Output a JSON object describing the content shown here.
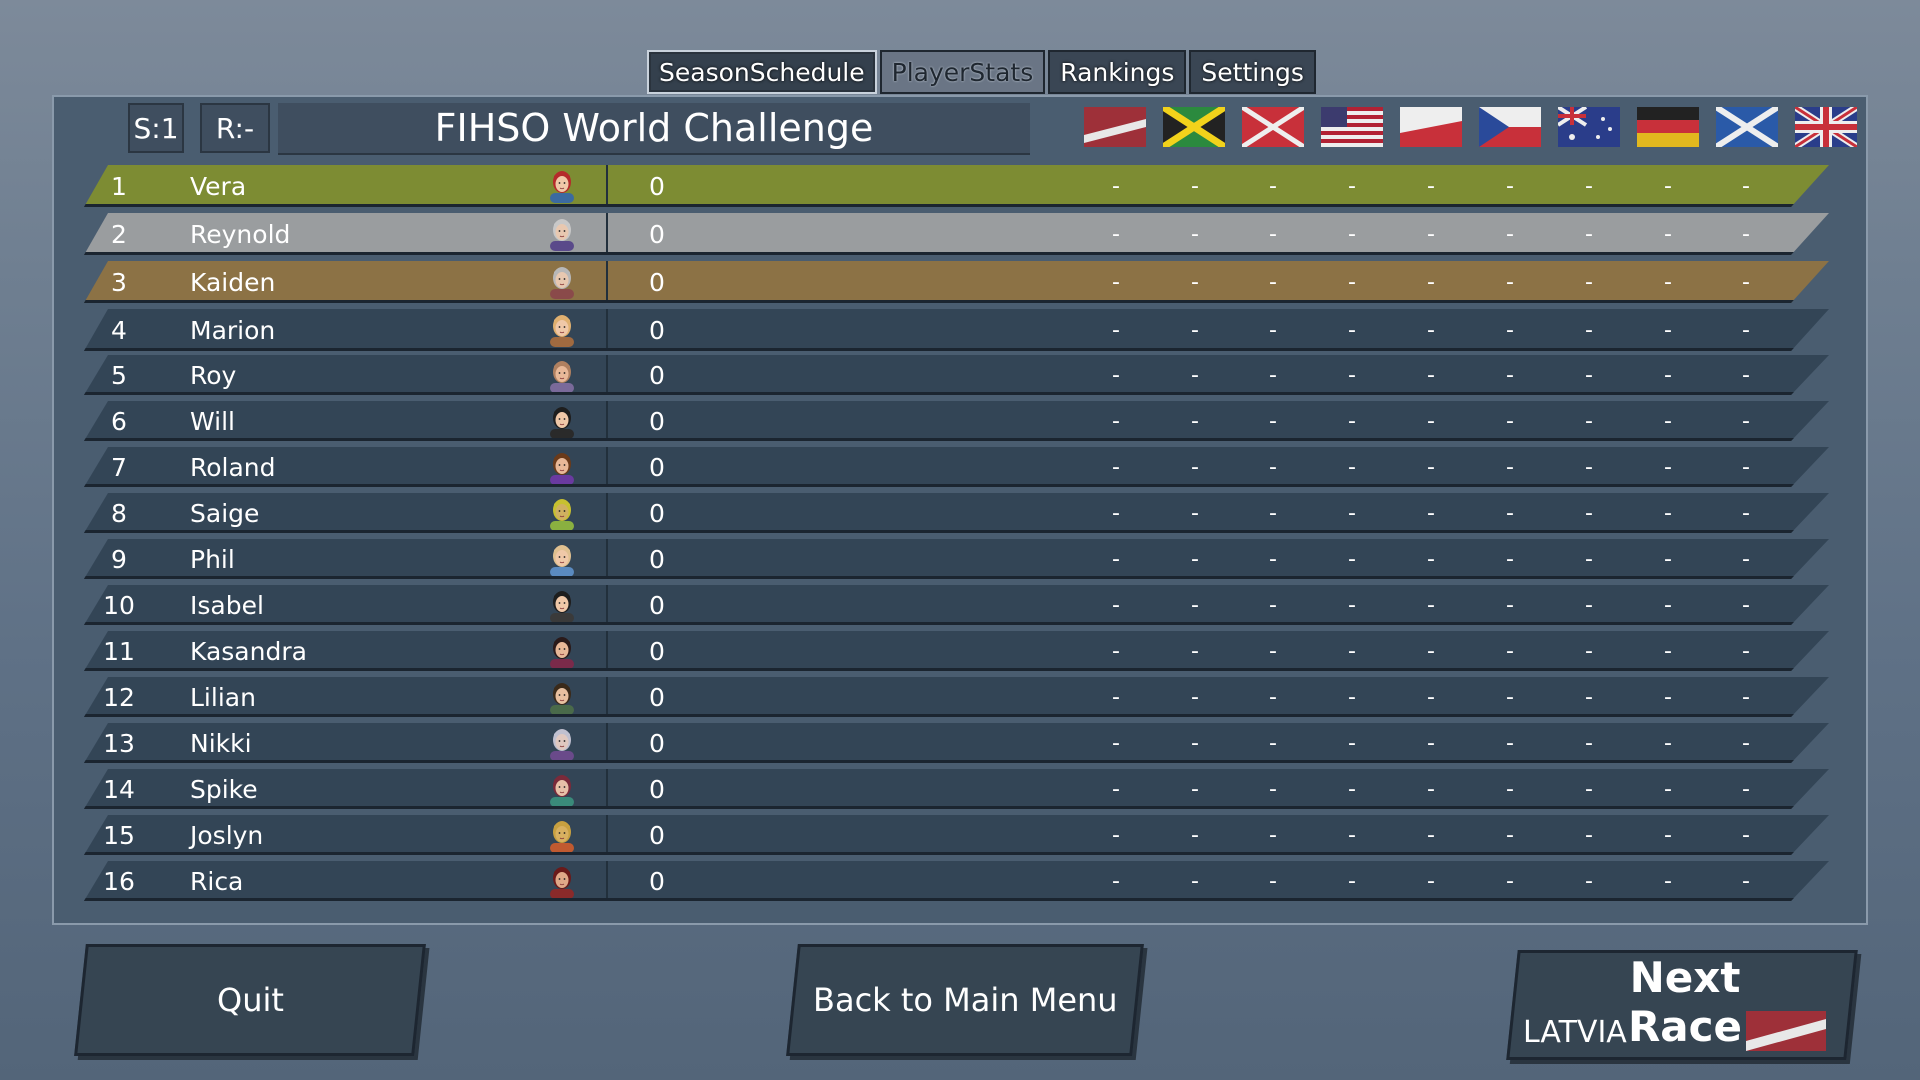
{
  "tabs": [
    {
      "label": "SeasonSchedule",
      "state": "active"
    },
    {
      "label": "PlayerStats",
      "state": "dim"
    },
    {
      "label": "Rankings",
      "state": "normal"
    },
    {
      "label": "Settings",
      "state": "normal"
    }
  ],
  "header": {
    "season": "S:1",
    "race": "R:-",
    "title": "FIHSO World Challenge"
  },
  "flags": [
    {
      "name": "latvia-flag"
    },
    {
      "name": "jamaica-flag"
    },
    {
      "name": "red-cross-flag"
    },
    {
      "name": "usa-flag"
    },
    {
      "name": "poland-flag"
    },
    {
      "name": "czech-flag"
    },
    {
      "name": "australia-flag"
    },
    {
      "name": "germany-flag"
    },
    {
      "name": "scotland-flag"
    },
    {
      "name": "uk-flag"
    }
  ],
  "standings": [
    {
      "pos": "1",
      "name": "Vera",
      "score": "0",
      "results": [
        "-",
        "-",
        "-",
        "-",
        "-",
        "-",
        "-",
        "-",
        "-",
        "-"
      ]
    },
    {
      "pos": "2",
      "name": "Reynold",
      "score": "0",
      "results": [
        "-",
        "-",
        "-",
        "-",
        "-",
        "-",
        "-",
        "-",
        "-",
        "-"
      ]
    },
    {
      "pos": "3",
      "name": "Kaiden",
      "score": "0",
      "results": [
        "-",
        "-",
        "-",
        "-",
        "-",
        "-",
        "-",
        "-",
        "-",
        "-"
      ]
    },
    {
      "pos": "4",
      "name": "Marion",
      "score": "0",
      "results": [
        "-",
        "-",
        "-",
        "-",
        "-",
        "-",
        "-",
        "-",
        "-",
        "-"
      ]
    },
    {
      "pos": "5",
      "name": "Roy",
      "score": "0",
      "results": [
        "-",
        "-",
        "-",
        "-",
        "-",
        "-",
        "-",
        "-",
        "-",
        "-"
      ]
    },
    {
      "pos": "6",
      "name": "Will",
      "score": "0",
      "results": [
        "-",
        "-",
        "-",
        "-",
        "-",
        "-",
        "-",
        "-",
        "-",
        "-"
      ]
    },
    {
      "pos": "7",
      "name": "Roland",
      "score": "0",
      "results": [
        "-",
        "-",
        "-",
        "-",
        "-",
        "-",
        "-",
        "-",
        "-",
        "-"
      ]
    },
    {
      "pos": "8",
      "name": "Saige",
      "score": "0",
      "results": [
        "-",
        "-",
        "-",
        "-",
        "-",
        "-",
        "-",
        "-",
        "-",
        "-"
      ]
    },
    {
      "pos": "9",
      "name": "Phil",
      "score": "0",
      "results": [
        "-",
        "-",
        "-",
        "-",
        "-",
        "-",
        "-",
        "-",
        "-",
        "-"
      ]
    },
    {
      "pos": "10",
      "name": "Isabel",
      "score": "0",
      "results": [
        "-",
        "-",
        "-",
        "-",
        "-",
        "-",
        "-",
        "-",
        "-",
        "-"
      ]
    },
    {
      "pos": "11",
      "name": "Kasandra",
      "score": "0",
      "results": [
        "-",
        "-",
        "-",
        "-",
        "-",
        "-",
        "-",
        "-",
        "-",
        "-"
      ]
    },
    {
      "pos": "12",
      "name": "Lilian",
      "score": "0",
      "results": [
        "-",
        "-",
        "-",
        "-",
        "-",
        "-",
        "-",
        "-",
        "-",
        "-"
      ]
    },
    {
      "pos": "13",
      "name": "Nikki",
      "score": "0",
      "results": [
        "-",
        "-",
        "-",
        "-",
        "-",
        "-",
        "-",
        "-",
        "-",
        "-"
      ]
    },
    {
      "pos": "14",
      "name": "Spike",
      "score": "0",
      "results": [
        "-",
        "-",
        "-",
        "-",
        "-",
        "-",
        "-",
        "-",
        "-",
        "-"
      ]
    },
    {
      "pos": "15",
      "name": "Joslyn",
      "score": "0",
      "results": [
        "-",
        "-",
        "-",
        "-",
        "-",
        "-",
        "-",
        "-",
        "-",
        "-"
      ]
    },
    {
      "pos": "16",
      "name": "Rica",
      "score": "0",
      "results": [
        "-",
        "-",
        "-",
        "-",
        "-",
        "-",
        "-",
        "-",
        "-",
        "-"
      ]
    }
  ],
  "avatars": [
    {
      "hair": "#b52a2a",
      "skin": "#f0c8a8",
      "shirt": "#3b6aa0"
    },
    {
      "hair": "#c8c8c8",
      "skin": "#e8c8b0",
      "shirt": "#5a4a8a"
    },
    {
      "hair": "#b8b8b8",
      "skin": "#e8c8b0",
      "shirt": "#8a4a4a"
    },
    {
      "hair": "#e0b070",
      "skin": "#f0c8a8",
      "shirt": "#a06a40"
    },
    {
      "hair": "#b08060",
      "skin": "#e8b898",
      "shirt": "#7a6a9a"
    },
    {
      "hair": "#1e1e1e",
      "skin": "#f0c8a8",
      "shirt": "#2a2a2a"
    },
    {
      "hair": "#6a3a1a",
      "skin": "#e8b898",
      "shirt": "#6a3aa0"
    },
    {
      "hair": "#c8c030",
      "skin": "#d0b060",
      "shirt": "#8ab040"
    },
    {
      "hair": "#e0c090",
      "skin": "#f0c8a8",
      "shirt": "#5a8ac0"
    },
    {
      "hair": "#1e1e1e",
      "skin": "#f0c8a8",
      "shirt": "#3a3a3a"
    },
    {
      "hair": "#2a1a1a",
      "skin": "#e8b898",
      "shirt": "#7a2a4a"
    },
    {
      "hair": "#3a2a1a",
      "skin": "#e8c0a0",
      "shirt": "#4a6a4a"
    },
    {
      "hair": "#c0c0d0",
      "skin": "#e0c8c0",
      "shirt": "#6a4a8a"
    },
    {
      "hair": "#7a2a3a",
      "skin": "#e8c0a8",
      "shirt": "#3a8a7a"
    },
    {
      "hair": "#c8a040",
      "skin": "#d8b060",
      "shirt": "#c05a30"
    },
    {
      "hair": "#6a1a1a",
      "skin": "#e0a888",
      "shirt": "#8a2a2a"
    }
  ],
  "buttons": {
    "quit": "Quit",
    "back": "Back to Main Menu",
    "next_race": "Next Race",
    "next_country": "LATVIA"
  },
  "colors": {
    "first_place": "#7d8c33",
    "second_place": "#9a9d9f",
    "third_place": "#8c7245",
    "row_default": "#334556",
    "panel": "#4a5d70"
  }
}
